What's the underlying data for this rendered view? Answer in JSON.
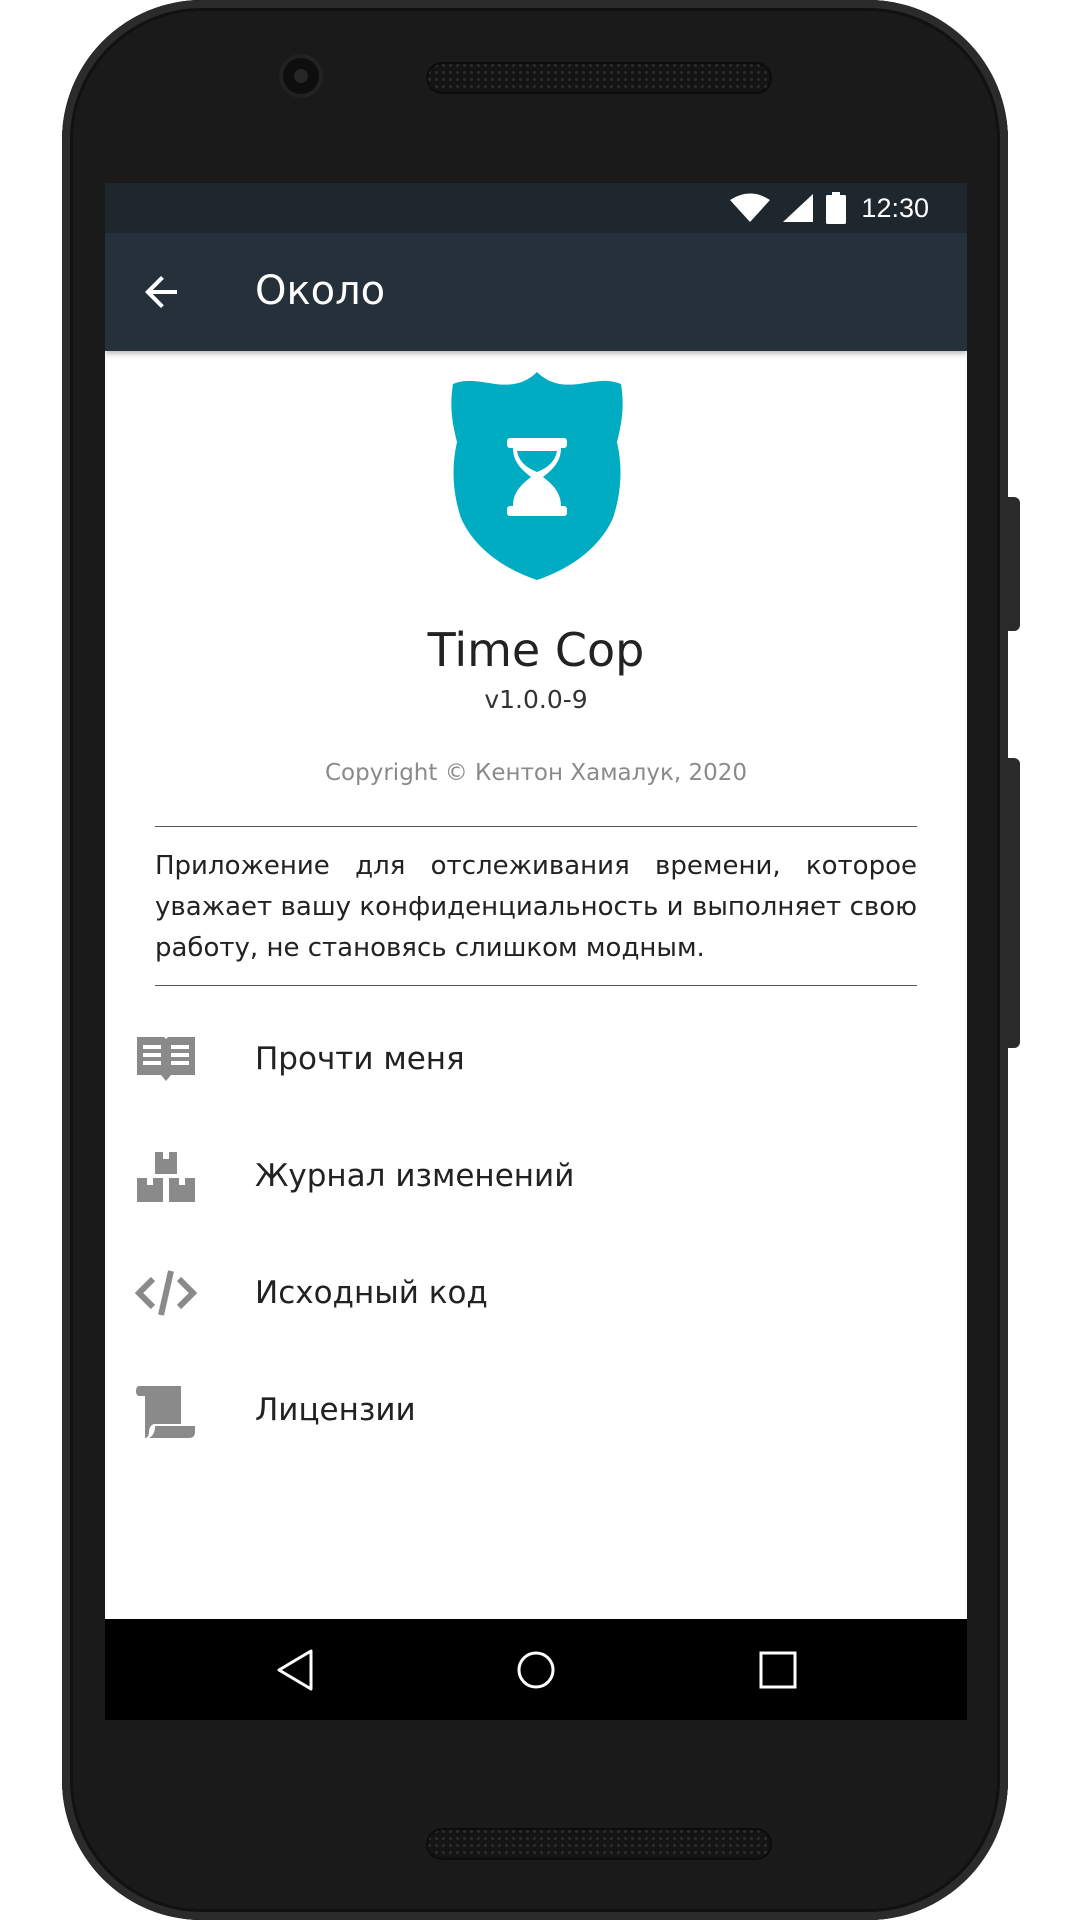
{
  "status_bar": {
    "time": "12:30"
  },
  "app_bar": {
    "title": "Около"
  },
  "about": {
    "app_name": "Time Cop",
    "version": "v1.0.0-9",
    "copyright": "Copyright © Кентон Хамалук, 2020",
    "description": "Приложение для отслеживания времени, которое уважает вашу конфиденциальность и выполняет свою работу, не становясь слишком модным."
  },
  "menu": {
    "items": [
      {
        "label": "Прочти меня",
        "icon": "book-icon"
      },
      {
        "label": "Журнал изменений",
        "icon": "boxes-icon"
      },
      {
        "label": "Исходный код",
        "icon": "code-icon"
      },
      {
        "label": "Лицензии",
        "icon": "scroll-icon"
      }
    ]
  },
  "colors": {
    "accent": "#00acc1",
    "status_bar": "#1e272e",
    "app_bar": "#25303a",
    "icon_gray": "#8a8a8a"
  }
}
